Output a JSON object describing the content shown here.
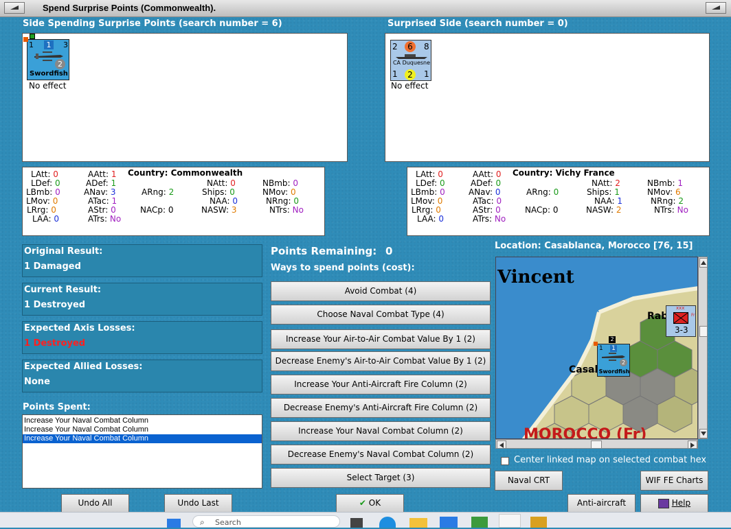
{
  "window": {
    "title": "Spend Surprise Points (Commonwealth)."
  },
  "left_side": {
    "header": "Side Spending Surprise Points (search number = 6)",
    "unit": {
      "name": "Swordfish",
      "top_left": "1",
      "top_mid": "1",
      "top_right": "3",
      "bottom_right": "2"
    },
    "effect": "No effect",
    "stats": {
      "country_label": "Country:",
      "country": "Commonwealth",
      "LAtt": "0",
      "LDef": "0",
      "LBmb": "0",
      "LMov": "0",
      "LRrg": "0",
      "LAA": "0",
      "AAtt": "1",
      "ADef": "1",
      "ANav": "3",
      "ATac": "1",
      "AStr": "0",
      "ATrs": "No",
      "ARng": "2",
      "NACp": "0",
      "NAtt": "0",
      "Ships": "0",
      "NAA": "0",
      "NASW": "3",
      "NBmb": "0",
      "NMov": "0",
      "NRng": "0",
      "NTrs": "No"
    }
  },
  "right_side": {
    "header": "Surprised Side (search number = 0)",
    "unit": {
      "name": "CA Duquesne",
      "top_left": "2",
      "top_mid": "6",
      "top_right": "8",
      "bottom_left": "1",
      "bottom_mid": "2",
      "bottom_right": "1"
    },
    "effect": "No effect",
    "stats": {
      "country_label": "Country:",
      "country": "Vichy France",
      "LAtt": "0",
      "LDef": "0",
      "LBmb": "0",
      "LMov": "0",
      "LRrg": "0",
      "LAA": "0",
      "AAtt": "0",
      "ADef": "0",
      "ANav": "0",
      "ATac": "0",
      "AStr": "0",
      "ATrs": "No",
      "ARng": "0",
      "NACp": "0",
      "NAtt": "2",
      "Ships": "1",
      "NAA": "1",
      "NASW": "2",
      "NBmb": "1",
      "NMov": "6",
      "NRng": "2",
      "NTrs": "No"
    }
  },
  "results": {
    "original": {
      "label": "Original Result:",
      "value": "1 Damaged"
    },
    "current": {
      "label": "Current Result:",
      "value": "1 Destroyed"
    },
    "axis": {
      "label": "Expected Axis Losses:",
      "value": "1 Destroyed"
    },
    "allied": {
      "label": "Expected Allied Losses:",
      "value": "None"
    }
  },
  "points_spent": {
    "label": "Points Spent:",
    "items": [
      "Increase Your Naval Combat Column",
      "Increase Your Naval Combat Column",
      "Increase Your Naval Combat Column"
    ],
    "selected_index": 2
  },
  "spend": {
    "remaining_label": "Points Remaining:",
    "remaining_value": "0",
    "ways_label": "Ways to spend points (cost):",
    "options": [
      "Avoid Combat (4)",
      "Choose Naval Combat Type (4)",
      "Increase Your Air-to-Air Combat Value By 1 (2)",
      "Decrease Enemy's Air-to-Air Combat Value By 1 (2)",
      "Increase Your Anti-Aircraft Fire Column (2)",
      "Decrease Enemy's Anti-Aircraft Fire Column (2)",
      "Increase Your Naval Combat Column (2)",
      "Decrease Enemy's Naval Combat Column (2)",
      "Select Target (3)"
    ]
  },
  "map": {
    "location": "Location: Casablanca, Morocco [76, 15]",
    "label_vincent": "Vincent",
    "label_rab": "Rab",
    "label_casa": "Casal",
    "label_morocco": "MOROCCO (Fr)",
    "counter_value": "3-3",
    "counter_flag": "xxx",
    "counter_side": "Fr",
    "air_unit_name": "Swordfish",
    "air_unit_top_left": "1",
    "air_unit_top_mid": "1",
    "air_unit_bottom_right": "2",
    "stack_badge": "2",
    "center_checkbox_label": "Center linked map on selected combat hex",
    "center_checked": false
  },
  "buttons": {
    "undo_all": "Undo All",
    "undo_last": "Undo Last",
    "ok": "OK",
    "naval_crt": "Naval CRT",
    "wif_fe_charts": "WIF FE Charts",
    "anti_aircraft_crt": "Anti-aircraft CRT",
    "help": "Help"
  },
  "taskbar": {
    "search_placeholder": "Search"
  },
  "colors": {
    "red": "#e02020",
    "green": "#1a9a1a",
    "blue": "#1a2fd8",
    "orange": "#e07a00",
    "purple": "#a020c0",
    "panel_blue": "#2f8cb8"
  }
}
